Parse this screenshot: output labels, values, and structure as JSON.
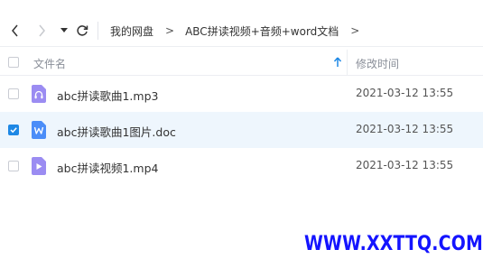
{
  "breadcrumb": [
    "我的网盘",
    "ABC拼读视频+音频+word文档"
  ],
  "breadcrumb_separator": ">",
  "columns": {
    "name": "文件名",
    "modified": "修改时间"
  },
  "files": [
    {
      "name": "abc拼读歌曲1.mp3",
      "modified": "2021-03-12 13:55",
      "type": "audio",
      "icon": "audio-file-icon",
      "color": "#9b8cf2",
      "selected": false
    },
    {
      "name": "abc拼读歌曲1图片.doc",
      "modified": "2021-03-12 13:55",
      "type": "word",
      "icon": "word-file-icon",
      "color": "#4b8df8",
      "selected": true
    },
    {
      "name": "abc拼读视频1.mp4",
      "modified": "2021-03-12 13:55",
      "type": "video",
      "icon": "video-file-icon",
      "color": "#9b8cf2",
      "selected": false
    }
  ],
  "watermark": "WWW.XXTTQ.COM",
  "colors": {
    "accent": "#1e88e5",
    "selected_row": "#eef6fd",
    "watermark": "#1414ff"
  }
}
